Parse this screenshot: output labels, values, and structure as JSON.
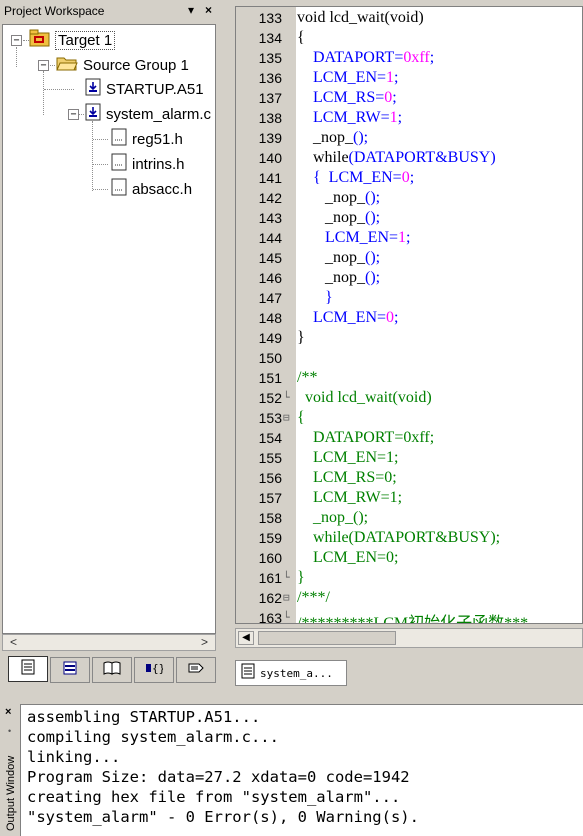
{
  "workspace": {
    "title": "Project Workspace",
    "pin_glyph": "▾",
    "close_glyph": "×",
    "tree": {
      "target": "Target 1",
      "group": "Source Group 1",
      "files": [
        "STARTUP.A51",
        "system_alarm.c"
      ],
      "includes": [
        "reg51.h",
        "intrins.h",
        "absacc.h"
      ]
    },
    "scroll_left": "<",
    "scroll_right": ">",
    "tabs": [
      "files-tab",
      "regs-tab",
      "books-tab",
      "functions-tab",
      "templates-tab"
    ]
  },
  "editor": {
    "tab_label": "system_a...",
    "lines": [
      {
        "n": "133",
        "fold": "",
        "text": "void lcd_wait(void)",
        "color": "black"
      },
      {
        "n": "134",
        "fold": "",
        "text": "{",
        "color": "black"
      },
      {
        "n": "135",
        "fold": "",
        "pre": "    ",
        "a": "DATAPORT=",
        "b": "0xff",
        "c": ";",
        "color": "mixed"
      },
      {
        "n": "136",
        "fold": "",
        "pre": "    ",
        "a": "LCM_EN=",
        "b": "1",
        "c": ";",
        "color": "mixed"
      },
      {
        "n": "137",
        "fold": "",
        "pre": "    ",
        "a": "LCM_RS=",
        "b": "0",
        "c": ";",
        "color": "mixed"
      },
      {
        "n": "138",
        "fold": "",
        "pre": "    ",
        "a": "LCM_RW=",
        "b": "1",
        "c": ";",
        "color": "mixed"
      },
      {
        "n": "139",
        "fold": "",
        "pre": "    ",
        "a": "_nop_",
        "b": "()",
        "c": ";",
        "color": "mixed2"
      },
      {
        "n": "140",
        "fold": "",
        "pre": "    ",
        "a": "while",
        "b": "(DATAPORT&BUSY)",
        "c": "",
        "color": "mixed3"
      },
      {
        "n": "141",
        "fold": "",
        "pre": "    ",
        "a": "{  LCM_EN=",
        "b": "0",
        "c": ";",
        "color": "mixed"
      },
      {
        "n": "142",
        "fold": "",
        "pre": "       ",
        "a": "_nop_",
        "b": "()",
        "c": ";",
        "color": "mixed2"
      },
      {
        "n": "143",
        "fold": "",
        "pre": "       ",
        "a": "_nop_",
        "b": "()",
        "c": ";",
        "color": "mixed2"
      },
      {
        "n": "144",
        "fold": "",
        "pre": "       ",
        "a": "LCM_EN=",
        "b": "1",
        "c": ";",
        "color": "mixed"
      },
      {
        "n": "145",
        "fold": "",
        "pre": "       ",
        "a": "_nop_",
        "b": "()",
        "c": ";",
        "color": "mixed2"
      },
      {
        "n": "146",
        "fold": "",
        "pre": "       ",
        "a": "_nop_",
        "b": "()",
        "c": ";",
        "color": "mixed2"
      },
      {
        "n": "147",
        "fold": "",
        "text": "       }",
        "color": "blue"
      },
      {
        "n": "148",
        "fold": "",
        "pre": "    ",
        "a": "LCM_EN=",
        "b": "0",
        "c": ";",
        "color": "mixed"
      },
      {
        "n": "149",
        "fold": "",
        "text": "}",
        "color": "black"
      },
      {
        "n": "150",
        "fold": "",
        "text": "",
        "color": "black"
      },
      {
        "n": "151",
        "fold": "",
        "text": "/**",
        "color": "green"
      },
      {
        "n": "152",
        "fold": "└",
        "text": "  void lcd_wait(void)",
        "color": "green"
      },
      {
        "n": "153",
        "fold": "⊟",
        "text": "{",
        "color": "green"
      },
      {
        "n": "154",
        "fold": "",
        "text": "    DATAPORT=0xff;",
        "color": "green"
      },
      {
        "n": "155",
        "fold": "",
        "text": "    LCM_EN=1;",
        "color": "green"
      },
      {
        "n": "156",
        "fold": "",
        "text": "    LCM_RS=0;",
        "color": "green"
      },
      {
        "n": "157",
        "fold": "",
        "text": "    LCM_RW=1;",
        "color": "green"
      },
      {
        "n": "158",
        "fold": "",
        "text": "    _nop_();",
        "color": "green"
      },
      {
        "n": "159",
        "fold": "",
        "text": "    while(DATAPORT&BUSY);",
        "color": "green"
      },
      {
        "n": "160",
        "fold": "",
        "text": "    LCM_EN=0;",
        "color": "green"
      },
      {
        "n": "161",
        "fold": "└",
        "text": "}",
        "color": "green"
      },
      {
        "n": "162",
        "fold": "⊟",
        "text": "/***/",
        "color": "green"
      },
      {
        "n": "163",
        "fold": "└",
        "text": "/*********LCM初始化子函数***",
        "color": "green"
      }
    ]
  },
  "output": {
    "side_label": "Output Window",
    "close_glyph": "×",
    "lines": [
      "assembling STARTUP.A51...",
      "compiling system_alarm.c...",
      "linking...",
      "Program Size: data=27.2 xdata=0 code=1942",
      "creating hex file from \"system_alarm\"...",
      "\"system_alarm\" - 0 Error(s), 0 Warning(s)."
    ]
  },
  "colors": {
    "keyword": "#000000",
    "number": "#ff00ff",
    "ident": "#0000ff",
    "comment": "#008000",
    "chrome": "#d4d0c8"
  }
}
